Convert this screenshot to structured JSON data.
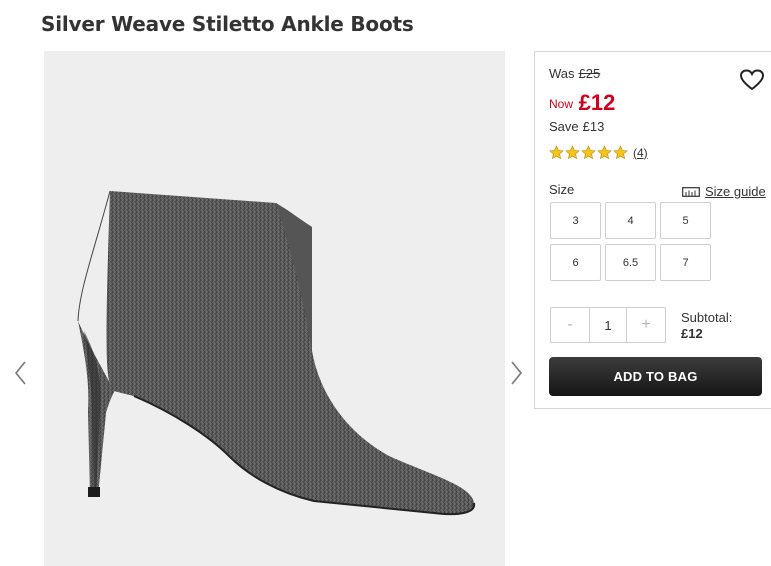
{
  "product": {
    "title": "Silver Weave Stiletto Ankle Boots"
  },
  "price": {
    "was_label": "Was",
    "was_amount": "£25",
    "now_label": "Now",
    "now_amount": "£12",
    "save_label": "Save",
    "save_amount": "£13"
  },
  "rating": {
    "stars": 5,
    "reviews": "(4)"
  },
  "size": {
    "label": "Size",
    "guide_label": "Size guide",
    "options": [
      "3",
      "4",
      "5",
      "6",
      "6.5",
      "7"
    ]
  },
  "quantity": {
    "minus": "-",
    "value": "1",
    "plus": "+"
  },
  "subtotal": {
    "label": "Subtotal:",
    "value": "£12"
  },
  "actions": {
    "add_to_bag": "ADD TO BAG"
  },
  "icons": {
    "favorite": "heart-icon",
    "prev": "chevron-left-icon",
    "next": "chevron-right-icon",
    "size_guide": "ruler-icon",
    "star": "star-icon"
  },
  "colors": {
    "price_red": "#d0021b",
    "star_yellow": "#f5c518",
    "button_dark": "#222222"
  }
}
